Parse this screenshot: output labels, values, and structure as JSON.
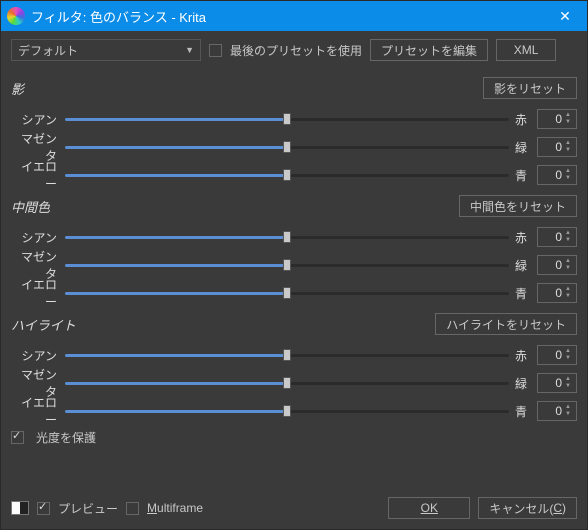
{
  "window": {
    "title": "フィルタ: 色のバランス - Krita"
  },
  "top": {
    "preset": "デフォルト",
    "use_last_preset": "最後のプリセットを使用",
    "edit_presets": "プリセットを編集",
    "xml": "XML"
  },
  "sections": [
    {
      "title": "影",
      "reset": "影をリセット"
    },
    {
      "title": "中間色",
      "reset": "中間色をリセット"
    },
    {
      "title": "ハイライト",
      "reset": "ハイライトをリセット"
    }
  ],
  "channels": [
    {
      "left": "シアン",
      "right": "赤",
      "value": "0"
    },
    {
      "left": "マゼンタ",
      "right": "緑",
      "value": "0"
    },
    {
      "left": "イエロー",
      "right": "青",
      "value": "0"
    }
  ],
  "preserve_luminosity": "光度を保護",
  "preview": "プレビュー",
  "multiframe": "Multiframe",
  "ok": "OK",
  "cancel": "キャンセル(C)"
}
